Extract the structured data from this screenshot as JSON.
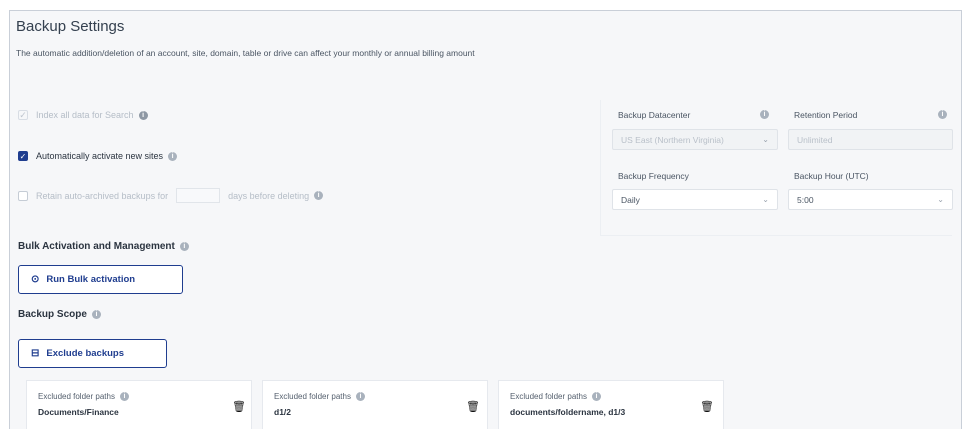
{
  "settings": {
    "title": "Backup Settings",
    "description": "The automatic addition/deletion of an account, site, domain, table or drive can affect your monthly or annual billing amount"
  },
  "options": {
    "index_label": "Index all data for Search",
    "activate_label": "Automatically activate new sites",
    "retain_prefix": "Retain auto-archived backups for",
    "retain_suffix": "days before deleting",
    "retain_value": ""
  },
  "right": {
    "datacenter_label": "Backup Datacenter",
    "datacenter_value": "US East (Northern Virginia)",
    "retention_label": "Retention Period",
    "retention_value": "Unlimited",
    "frequency_label": "Backup Frequency",
    "frequency_value": "Daily",
    "hour_label": "Backup Hour (UTC)",
    "hour_value": "5:00"
  },
  "bulk": {
    "heading": "Bulk Activation and Management",
    "button": "Run Bulk activation"
  },
  "scope": {
    "heading": "Backup Scope",
    "button": "Exclude backups"
  },
  "excluded": [
    {
      "label": "Excluded folder paths",
      "value": "Documents/Finance"
    },
    {
      "label": "Excluded folder paths",
      "value": "d1/2"
    },
    {
      "label": "Excluded folder paths",
      "value": "documents/foldername, d1/3"
    }
  ],
  "icons": {
    "info": "info-icon",
    "check": "checkmark-icon",
    "play": "play-circle-icon",
    "exclude": "exclude-icon",
    "trash": "trash-icon",
    "chevron": "chevron-down-icon"
  },
  "colors": {
    "accent": "#1f3d8f",
    "background": "#f6f7f9"
  }
}
